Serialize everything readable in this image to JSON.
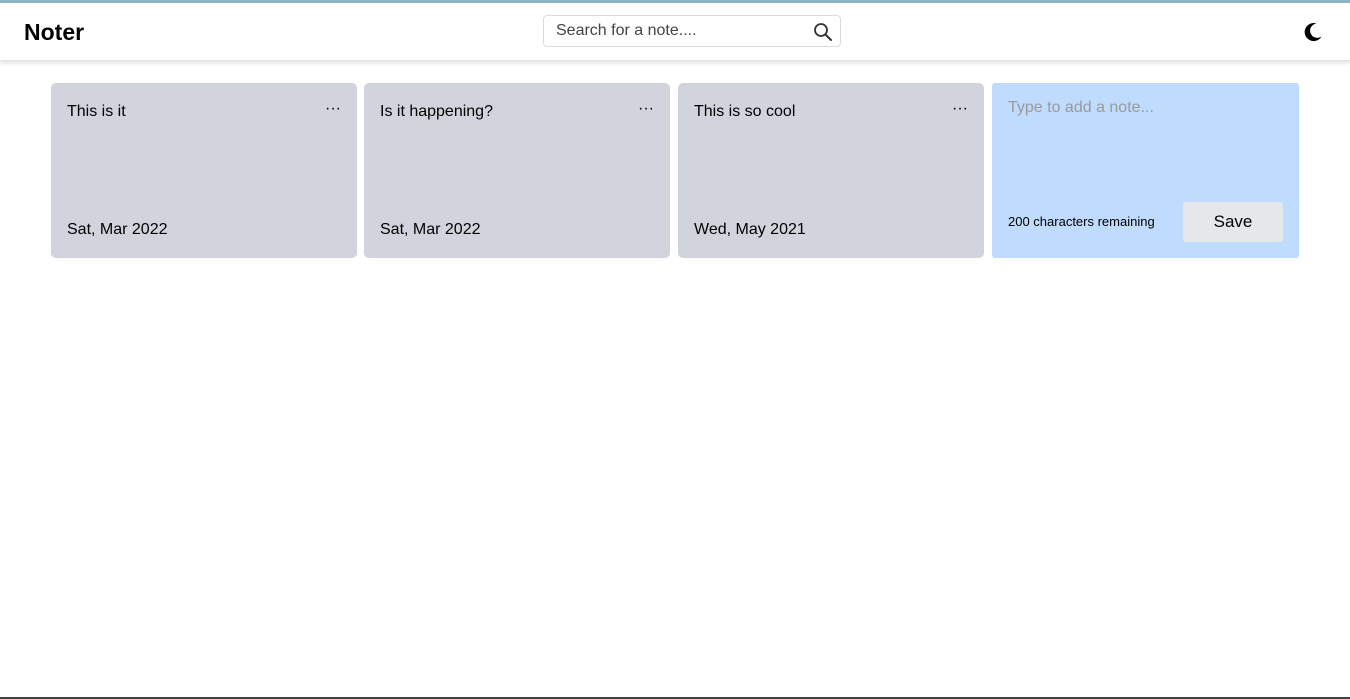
{
  "app": {
    "title": "Noter"
  },
  "search": {
    "placeholder": "Search for a note....",
    "value": "",
    "icon": "search-icon"
  },
  "theme_toggle": {
    "icon": "moon-icon"
  },
  "notes": [
    {
      "text": "This is it",
      "date": "Sat, Mar 2022",
      "menu_label": "···"
    },
    {
      "text": "Is it happening?",
      "date": "Sat, Mar 2022",
      "menu_label": "···"
    },
    {
      "text": "This is so cool",
      "date": "Wed, May 2021",
      "menu_label": "···"
    }
  ],
  "new_note": {
    "placeholder": "Type to add a note...",
    "value": "",
    "remaining_label": "200 characters remaining",
    "save_label": "Save"
  },
  "colors": {
    "note_background": "#d1d4dc",
    "new_note_background": "#bfdbfe",
    "save_button_background": "#e5e7eb",
    "top_accent": "#8fb3c7"
  }
}
